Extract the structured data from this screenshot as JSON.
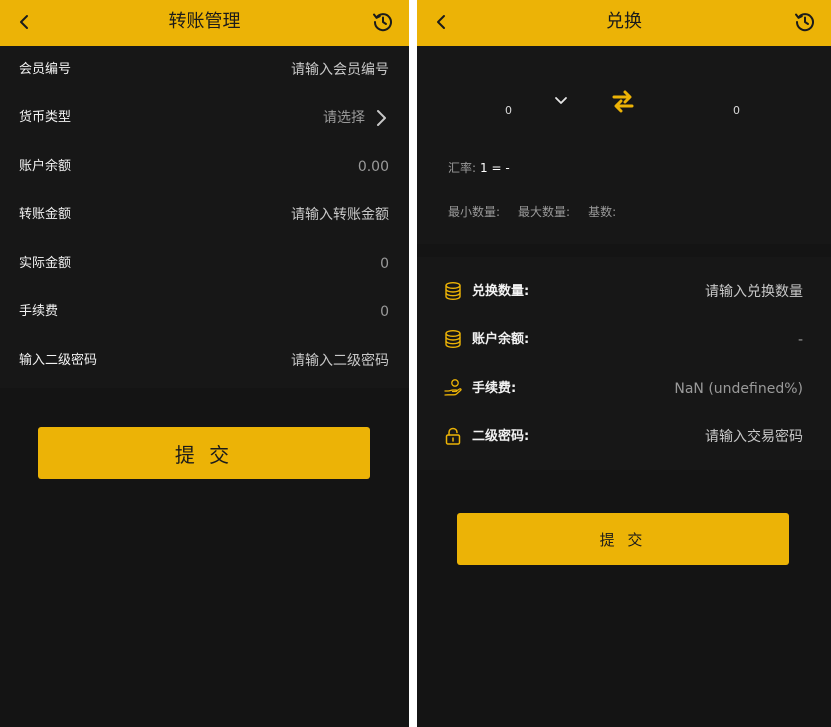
{
  "colors": {
    "accent": "#ecb306",
    "background": "#141414",
    "panel": "#171717"
  },
  "transfer": {
    "title": "转账管理",
    "fields": [
      {
        "label": "会员编号",
        "placeholder": "请输入会员编号"
      },
      {
        "label": "货币类型",
        "placeholder": "请选择"
      },
      {
        "label": "账户余额",
        "value": "0.00"
      },
      {
        "label": "转账金额",
        "placeholder": "请输入转账金额"
      },
      {
        "label": "实际金额",
        "value": "0"
      },
      {
        "label": "手续费",
        "value": "0"
      },
      {
        "label": "输入二级密码",
        "placeholder": "请输入二级密码"
      }
    ],
    "submit_label": "提 交"
  },
  "exchange": {
    "title": "兑换",
    "from_amount": "0",
    "to_amount": "0",
    "rate_label": "汇率:",
    "rate_value": "1 = -",
    "min_label": "最小数量:",
    "max_label": "最大数量:",
    "base_label": "基数:",
    "fields": [
      {
        "label": "兑换数量:",
        "placeholder": "请输入兑换数量",
        "icon": "coins-icon"
      },
      {
        "label": "账户余额:",
        "value": "-",
        "icon": "coins-icon"
      },
      {
        "label": "手续费:",
        "value": "NaN (undefined%)",
        "icon": "hand-coin-icon"
      },
      {
        "label": "二级密码:",
        "placeholder": "请输入交易密码",
        "icon": "lock-icon"
      }
    ],
    "submit_label": "提 交"
  }
}
